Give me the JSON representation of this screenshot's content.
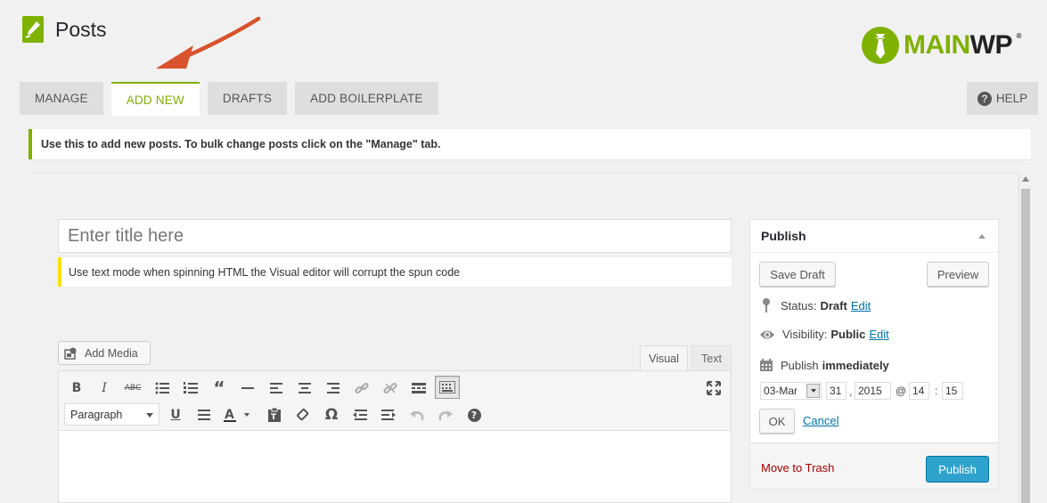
{
  "header": {
    "title": "Posts"
  },
  "logo": {
    "main": "MAIN",
    "wp": "WP",
    "reg": "®"
  },
  "tabs": [
    {
      "label": "MANAGE",
      "active": false
    },
    {
      "label": "ADD NEW",
      "active": true
    },
    {
      "label": "DRAFTS",
      "active": false
    },
    {
      "label": "ADD BOILERPLATE",
      "active": false
    }
  ],
  "help": {
    "label": "HELP"
  },
  "notice": {
    "text": "Use this to add new posts. To bulk change posts click on the \"Manage\" tab."
  },
  "editor": {
    "title_placeholder": "Enter title here",
    "warning": "Use text mode when spinning HTML the Visual editor will corrupt the spun code",
    "add_media": "Add Media",
    "mode_visual": "Visual",
    "mode_text": "Text",
    "format_select": "Paragraph"
  },
  "publish": {
    "title": "Publish",
    "save_draft": "Save Draft",
    "preview": "Preview",
    "status_label": "Status:",
    "status_value": "Draft",
    "status_edit": "Edit",
    "visibility_label": "Visibility:",
    "visibility_value": "Public",
    "visibility_edit": "Edit",
    "publish_label": "Publish",
    "publish_value": "immediately",
    "month": "03-Mar",
    "day": "31",
    "year": "2015",
    "hour": "14",
    "minute": "15",
    "ok": "OK",
    "cancel": "Cancel",
    "trash": "Move to Trash",
    "publish_button": "Publish"
  },
  "colors": {
    "accent": "#7fb100",
    "link": "#0073aa",
    "publish_button": "#2ea2cc",
    "warning": "#ffe100",
    "arrow": "#d9532d"
  }
}
